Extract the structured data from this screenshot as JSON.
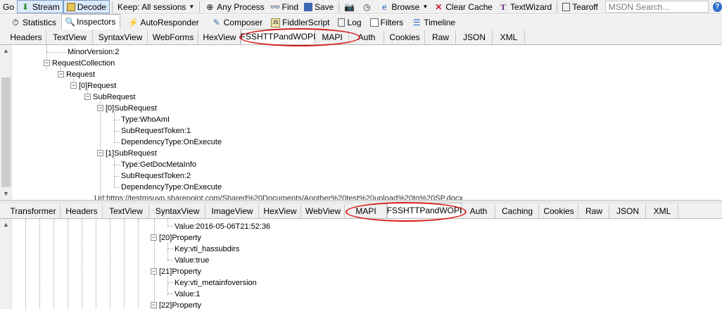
{
  "toolbar": {
    "go": "Go",
    "stream": "Stream",
    "decode": "Decode",
    "keep": "Keep: All sessions",
    "any_process": "Any Process",
    "find": "Find",
    "save": "Save",
    "browse": "Browse",
    "clear_cache": "Clear Cache",
    "textwizard": "TextWizard",
    "tearoff": "Tearoff",
    "search_placeholder": "MSDN Search...",
    "help": "?"
  },
  "main_tabs": {
    "statistics": "Statistics",
    "inspectors": "Inspectors",
    "autoresponder": "AutoResponder",
    "composer": "Composer",
    "fiddlerscript": "FiddlerScript",
    "log": "Log",
    "filters": "Filters",
    "timeline": "Timeline"
  },
  "request_tabs": [
    "Headers",
    "TextView",
    "SyntaxView",
    "WebForms",
    "HexView",
    "FSSHTTPandWOPI",
    "MAPI",
    "Auth",
    "Cookies",
    "Raw",
    "JSON",
    "XML"
  ],
  "response_tabs": [
    "Transformer",
    "Headers",
    "TextView",
    "SyntaxView",
    "ImageView",
    "HexView",
    "WebView",
    "MAPI",
    "FSSHTTPandWOPI",
    "Auth",
    "Caching",
    "Cookies",
    "Raw",
    "JSON",
    "XML"
  ],
  "request_tree": {
    "minor_version": "MinorVersion:2",
    "request_collection": "RequestCollection",
    "request": "Request",
    "request_0": "[0]Request",
    "subrequest": "SubRequest",
    "subrequest_0": "[0]SubRequest",
    "type_whoami": "Type:WhoAmI",
    "token_1": "SubRequestToken:1",
    "dep_1": "DependencyType:OnExecute",
    "subrequest_1": "[1]SubRequest",
    "type_getdoc": "Type:GetDocMetaInfo",
    "token_2": "SubRequestToken:2",
    "dep_2": "DependencyType:OnExecute",
    "url_clipped": "Url:https://testmsuyp.sharepoint.com/Shared%20Documents/Another%20test%20upload%20to%20SP.docx"
  },
  "response_tree": {
    "value_date": "Value:2016-05-06T21:52:36",
    "property_20": "[20]Property",
    "key_hassubdirs": "Key:vti_hassubdirs",
    "value_true": "Value:true",
    "property_21": "[21]Property",
    "key_metainfo": "Key:vti_metainfoversion",
    "value_1": "Value:1",
    "property_22": "[22]Property"
  },
  "colors": {
    "annotation": "#d81e1e",
    "toolbar_bg": "#f0f0f0"
  }
}
